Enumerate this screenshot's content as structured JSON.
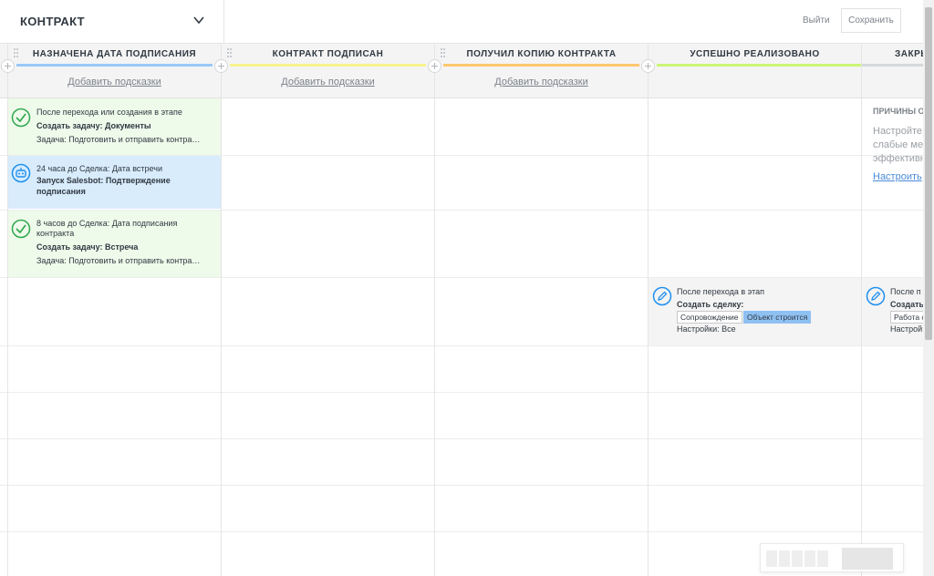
{
  "header": {
    "pipeline_title": "КОНТРАКТ",
    "exit_label": "Выйти",
    "save_label": "Сохранить"
  },
  "columns": [
    {
      "title": "НАЗНАЧЕНА ДАТА ПОДПИСАНИЯ",
      "color": "#99c9f7",
      "hint": "Добавить подсказки"
    },
    {
      "title": "КОНТРАКТ ПОДПИСАН",
      "color": "#f8f28f",
      "hint": "Добавить подсказки"
    },
    {
      "title": "ПОЛУЧИЛ КОПИЮ КОНТРАКТА",
      "color": "#ffc770",
      "hint": "Добавить подсказки"
    },
    {
      "title": "УСПЕШНО РЕАЛИЗОВАНО",
      "color": "#ccf576",
      "hint": ""
    },
    {
      "title": "ЗАКРЫ",
      "color": "#d5d8db",
      "hint": ""
    }
  ],
  "cards": {
    "task_documents": {
      "trigger": "После перехода или создания в этапе",
      "action": "Создать задачу: Документы",
      "detail": "Задача: Подготовить и отправить контра…",
      "icon": "check-circle-icon"
    },
    "salesbot": {
      "trigger": "24 часа до Сделка: Дата встречи",
      "action_line1": "Запуск Salesbot: Подтверждение",
      "action_line2": "подписания",
      "icon": "bot-icon"
    },
    "task_meeting": {
      "trigger_line1": "8 часов до Сделка: Дата подписания",
      "trigger_line2": "контракта",
      "action": "Создать задачу: Встреча",
      "detail": "Задача: Подготовить и отправить контра…",
      "icon": "check-circle-icon"
    },
    "create_deal": {
      "trigger": "После перехода в этап",
      "action": "Создать сделку:",
      "tag_pipeline": "Сопровождение",
      "tag_stage": "Объект строится",
      "settings": "Настройки: Все",
      "icon": "pencil-circle-icon"
    },
    "create_deal_cut": {
      "trigger": "После п",
      "action": "Создать",
      "tag": "Работа с",
      "settings": "Настрой",
      "icon": "pencil-circle-icon"
    }
  },
  "reasons": {
    "title": "ПРИЧИНЫ О",
    "text_line1": "Настройте",
    "text_line2": "слабые ме",
    "text_line3": "эффективн",
    "link": "Настроить"
  },
  "colors": {
    "green_card_bg": "#eefaea",
    "blue_card_bg": "#d8ecfc",
    "grey_card_bg": "#f4f4f4",
    "icon_green": "#2fa84f",
    "icon_blue": "#1f8ff0"
  }
}
